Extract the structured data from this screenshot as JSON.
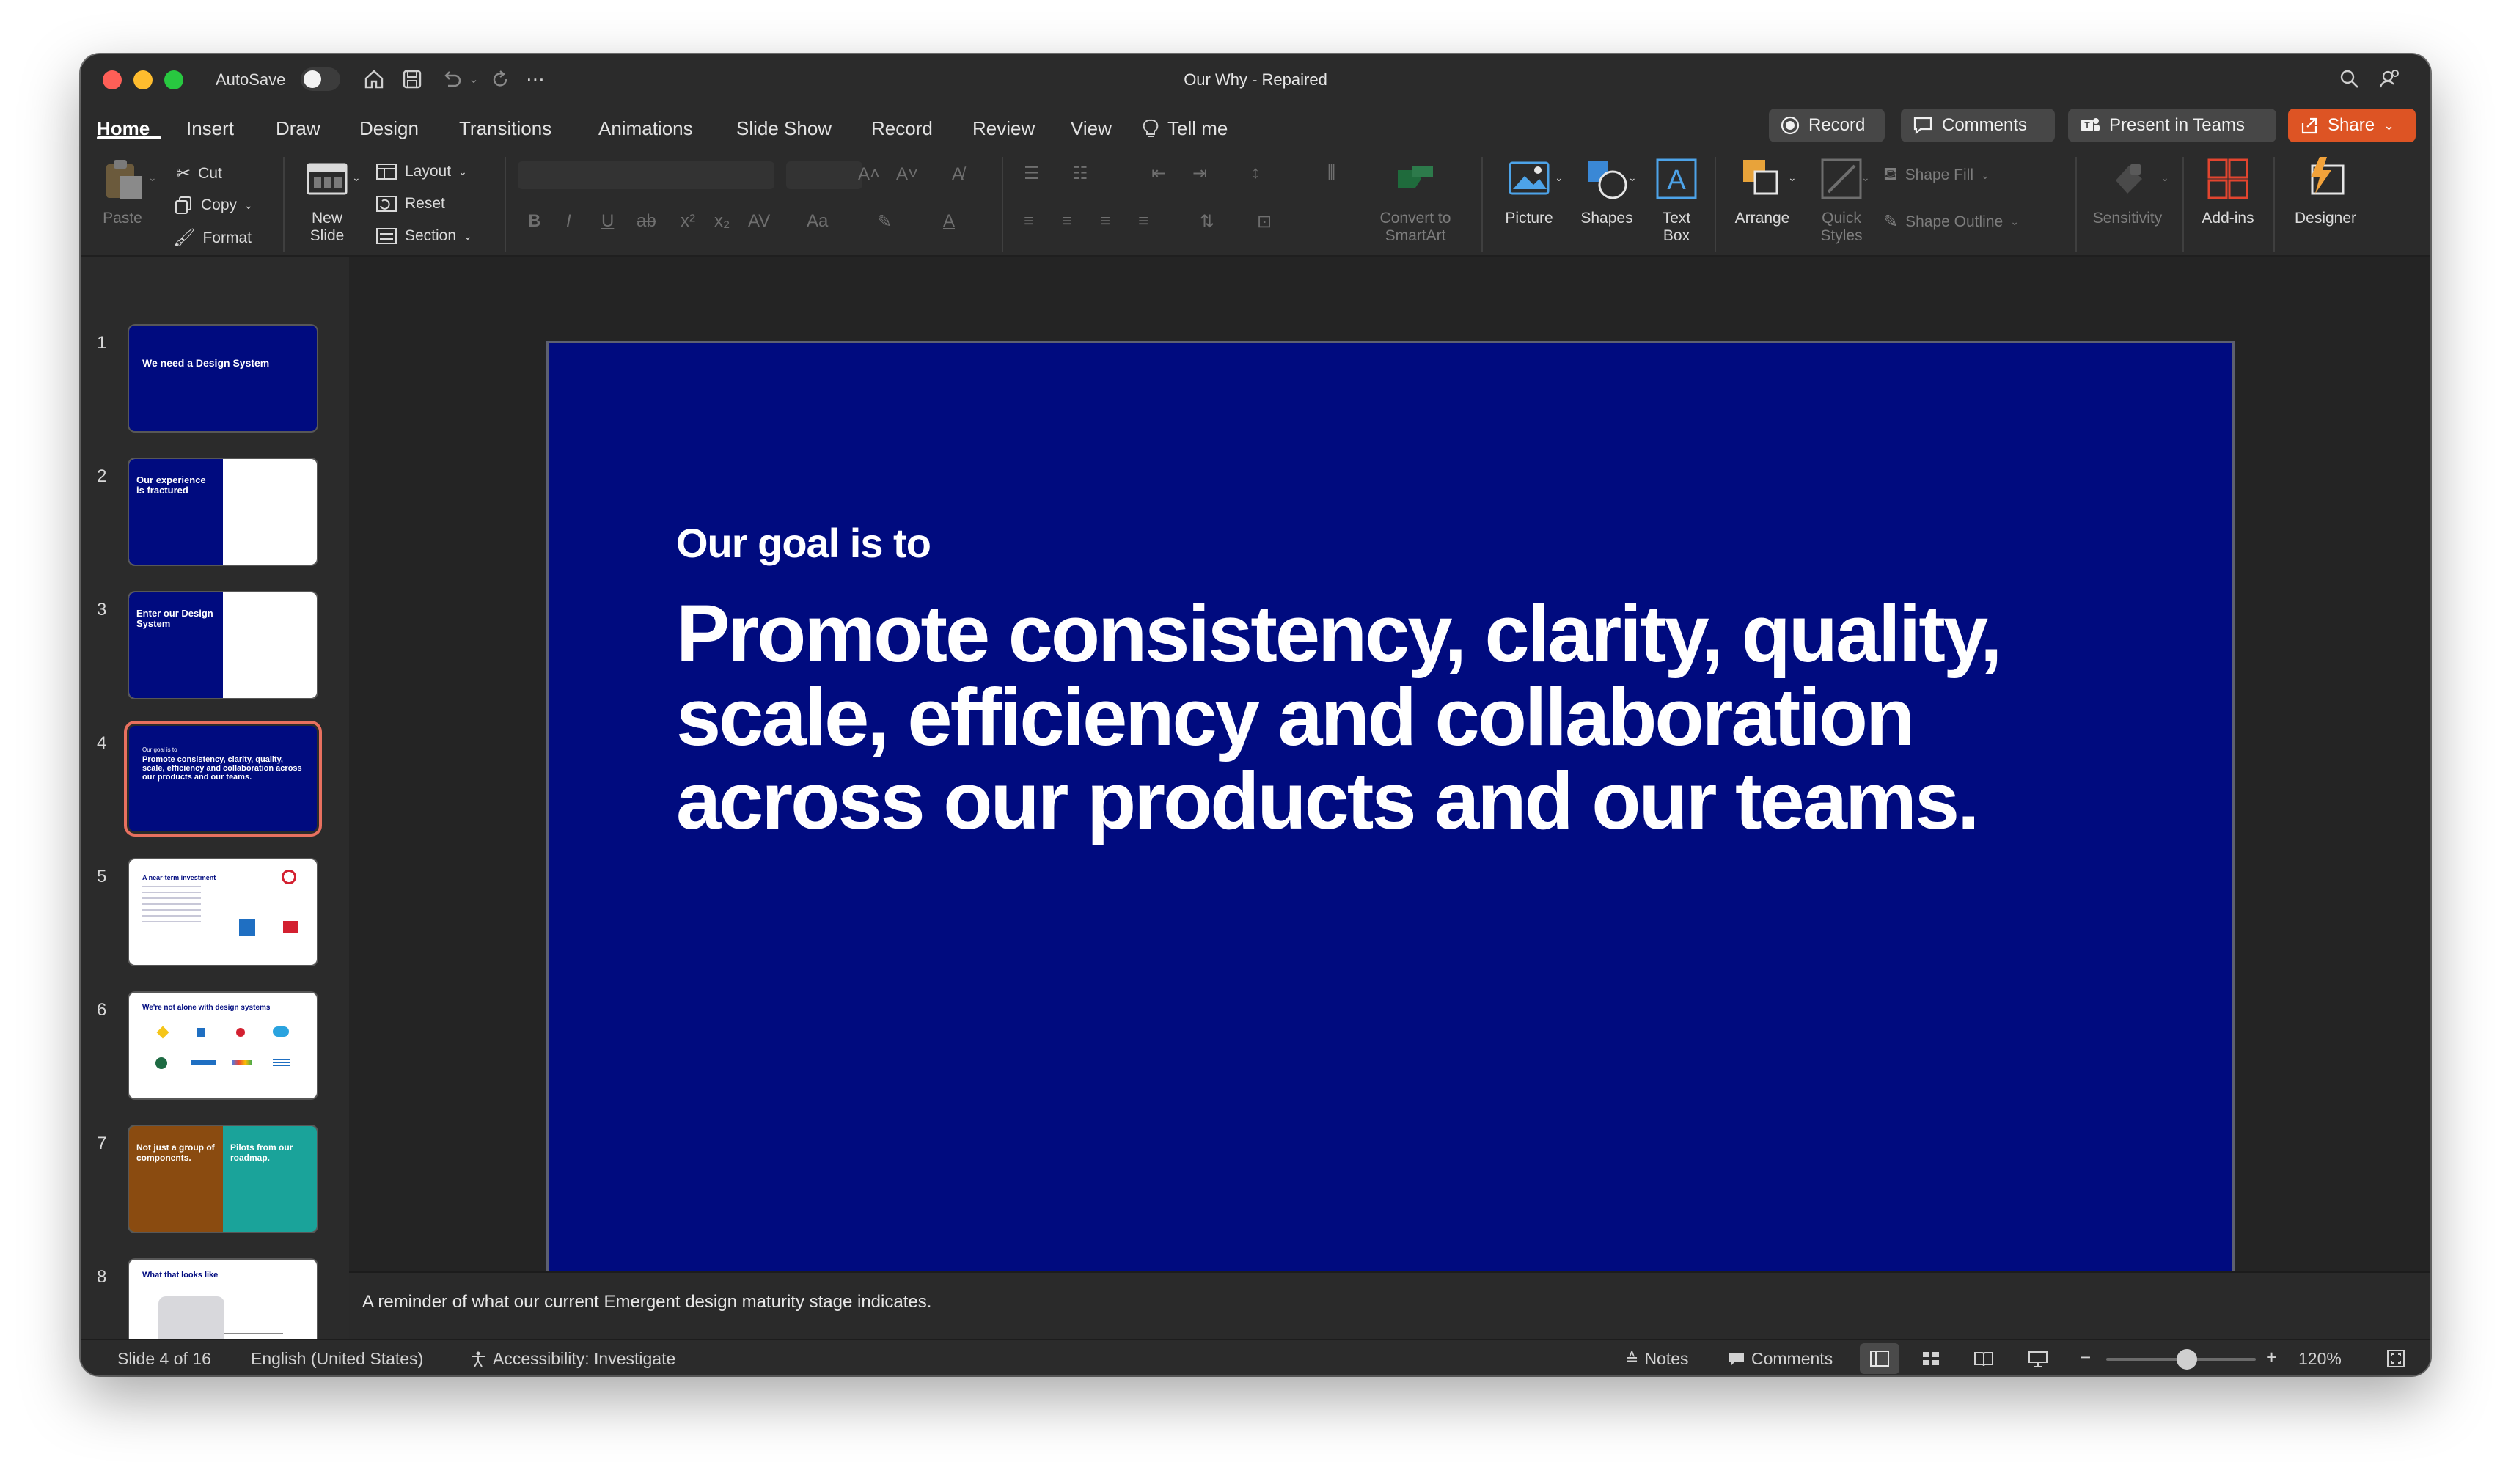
{
  "window": {
    "title": "Our Why  -  Repaired",
    "autosave_label": "AutoSave"
  },
  "tabs": [
    "Home",
    "Insert",
    "Draw",
    "Design",
    "Transitions",
    "Animations",
    "Slide Show",
    "Record",
    "Review",
    "View"
  ],
  "tell_me": "Tell me",
  "top_buttons": {
    "record": "Record",
    "comments": "Comments",
    "present": "Present in Teams",
    "share": "Share"
  },
  "ribbon": {
    "paste": "Paste",
    "cut": "Cut",
    "copy": "Copy",
    "format": "Format",
    "new_slide_1": "New",
    "new_slide_2": "Slide",
    "layout": "Layout",
    "reset": "Reset",
    "section": "Section",
    "convert_1": "Convert to",
    "convert_2": "SmartArt",
    "picture": "Picture",
    "shapes": "Shapes",
    "text_box_1": "Text",
    "text_box_2": "Box",
    "arrange": "Arrange",
    "quick_styles_1": "Quick",
    "quick_styles_2": "Styles",
    "shape_fill": "Shape Fill",
    "shape_outline": "Shape Outline",
    "sensitivity": "Sensitivity",
    "add_ins": "Add-ins",
    "designer": "Designer"
  },
  "thumbnails": [
    {
      "num": "1",
      "text": "We need a Design System"
    },
    {
      "num": "2",
      "text": "Our experience is fractured"
    },
    {
      "num": "3",
      "text": "Enter our Design System"
    },
    {
      "num": "4",
      "text": "Promote consistency, clarity, quality, scale, efficiency and collaboration across our products and our teams."
    },
    {
      "num": "5",
      "text": "A near-term investment"
    },
    {
      "num": "6",
      "text": "We're not alone with design systems"
    },
    {
      "num": "7",
      "text": "Not just a group of components."
    },
    {
      "num": "8",
      "text": "What that looks like"
    }
  ],
  "thumb7_right": "Pilots from our roadmap.",
  "thumb4_eyebrow": "Our goal is to",
  "slide": {
    "eyebrow": "Our goal is to",
    "headline": "Promote consistency, clarity, quality, scale, efficiency and collaboration across our products and our teams."
  },
  "notes": "A reminder of what our current Emergent design maturity stage indicates.",
  "status": {
    "slide_info": "Slide 4 of 16",
    "language": "English (United States)",
    "accessibility": "Accessibility: Investigate",
    "notes": "Notes",
    "comments": "Comments",
    "zoom": "120%"
  },
  "colors": {
    "slide_bg": "#000b7f",
    "share": "#dd5424",
    "selected_outline": "#e8705f",
    "thumb7_left": "#8a4b10",
    "thumb7_right": "#1aa39a"
  }
}
